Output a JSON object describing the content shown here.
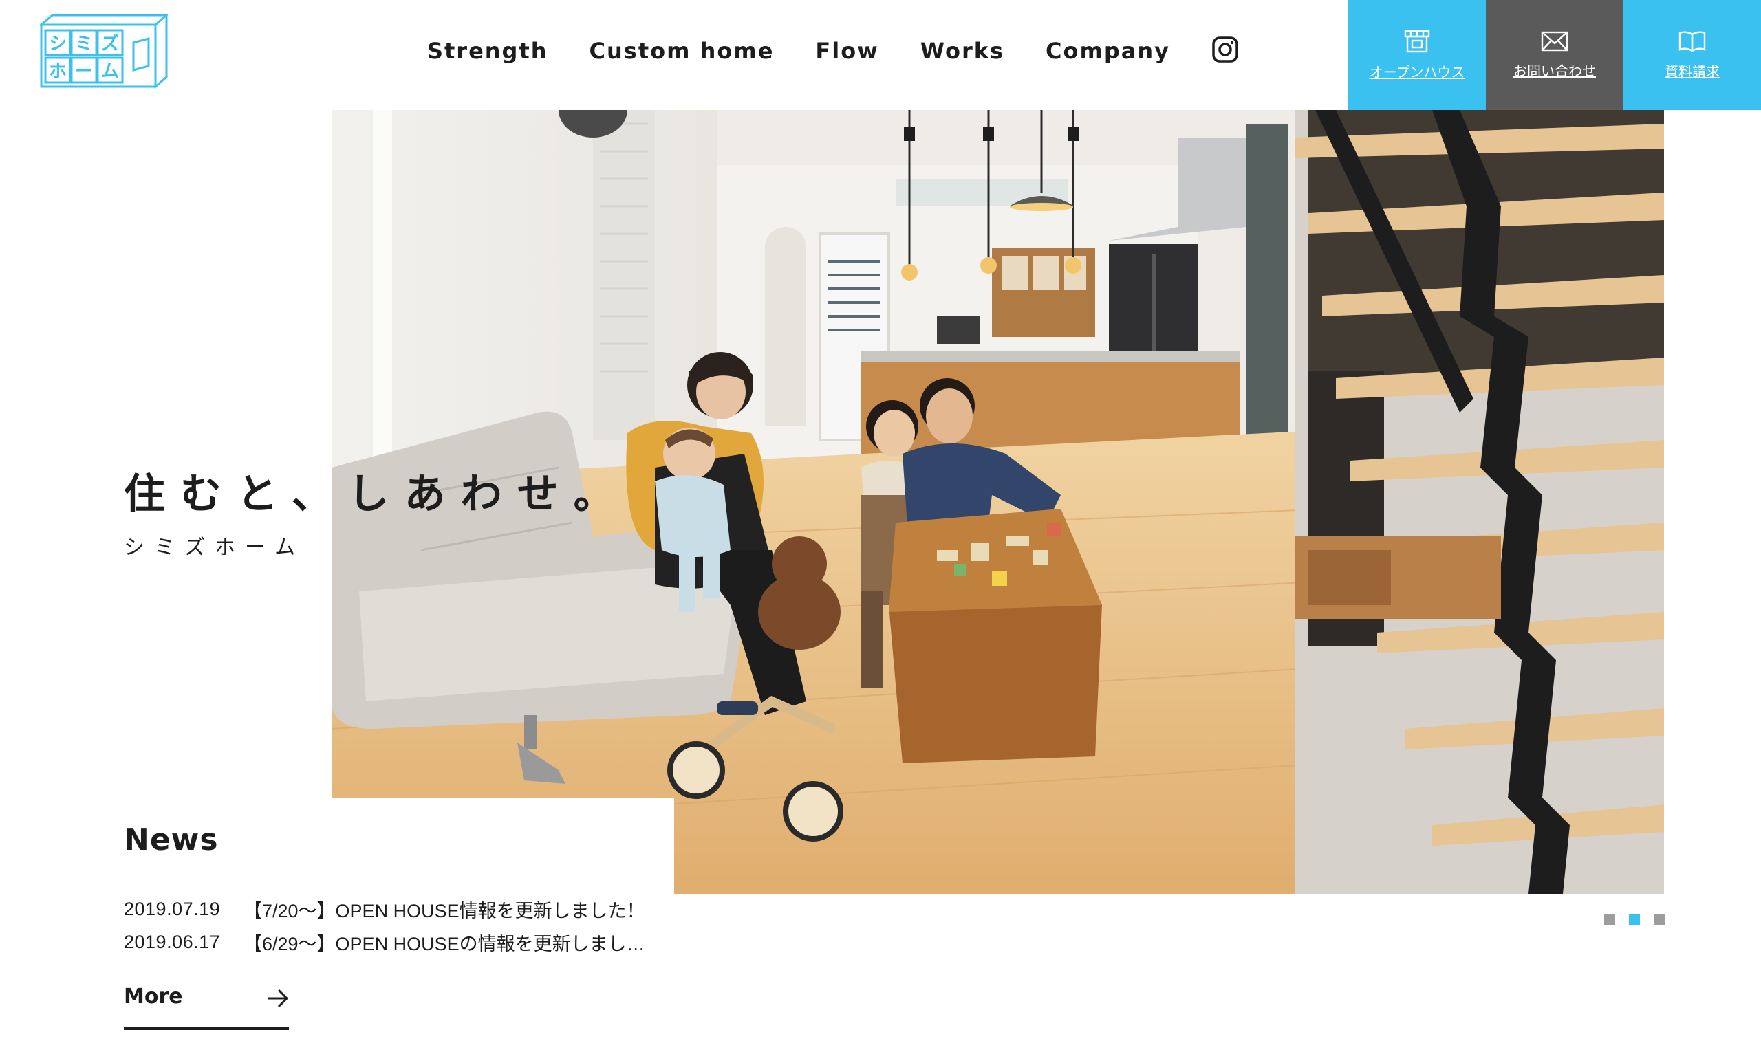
{
  "logo": {
    "chars": [
      "シ",
      "ミ",
      "ズ",
      "ホ",
      "ー",
      "ム"
    ]
  },
  "nav": {
    "items": [
      {
        "label": "Strength"
      },
      {
        "label": "Custom home"
      },
      {
        "label": "Flow"
      },
      {
        "label": "Works"
      },
      {
        "label": "Company"
      }
    ],
    "instagram_icon": "instagram-icon"
  },
  "cta": {
    "open_house": {
      "label": "オープンハウス",
      "icon": "house-icon"
    },
    "contact": {
      "label": "お問い合わせ",
      "icon": "mail-icon"
    },
    "documents": {
      "label": "資料請求",
      "icon": "book-icon"
    }
  },
  "hero": {
    "tagline": "住むと、しあわせ。",
    "subtitle": "シミズホーム"
  },
  "news": {
    "title": "News",
    "items": [
      {
        "date": "2019.07.19",
        "text": "【7/20〜】OPEN HOUSE情報を更新しました！"
      },
      {
        "date": "2019.06.17",
        "text": "【6/29〜】OPEN HOUSEの情報を更新しまし…"
      }
    ],
    "more_label": "More"
  },
  "slider": {
    "total": 3,
    "active_index": 1
  },
  "colors": {
    "accent": "#3bc1f0",
    "dark_button": "#5a5a5a",
    "text": "#1d1d1d"
  }
}
